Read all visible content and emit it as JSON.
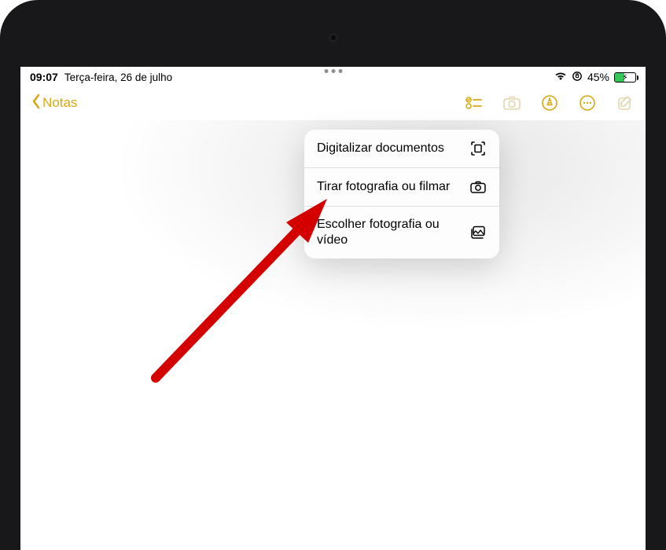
{
  "status": {
    "time": "09:07",
    "date": "Terça-feira, 26 de julho",
    "battery_percent": "45%"
  },
  "toolbar": {
    "back_label": "Notas"
  },
  "ghost_note_header": "",
  "menu": {
    "item1": "Digitalizar documentos",
    "item2": "Tirar fotografia ou filmar",
    "item3": "Escolher fotografia ou vídeo"
  }
}
